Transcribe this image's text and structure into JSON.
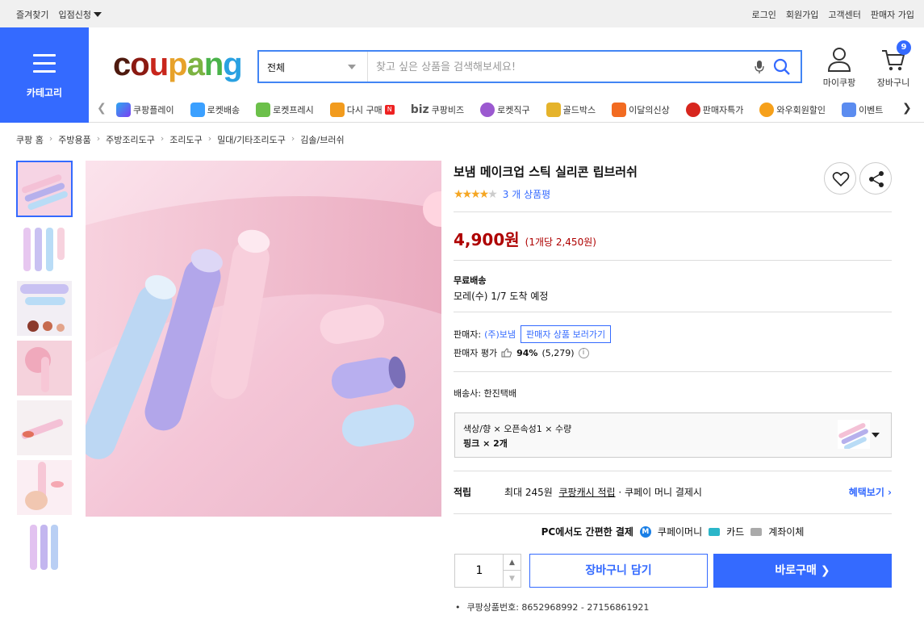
{
  "topbar": {
    "left": [
      "즐겨찾기",
      "입점신청"
    ],
    "right": [
      "로그인",
      "회원가입",
      "고객센터",
      "판매자 가입"
    ]
  },
  "header": {
    "category_label": "카테고리",
    "logo": "coupang",
    "search_category": "전체",
    "search_placeholder": "찾고 싶은 상품을 검색해보세요!",
    "mycoupang_label": "마이쿠팡",
    "cart_label": "장바구니",
    "cart_count": "9"
  },
  "services": [
    "쿠팡플레이",
    "로켓배송",
    "로켓프레시",
    "다시 구매",
    "쿠팡비즈",
    "로켓직구",
    "골드박스",
    "이달의신상",
    "판매자특가",
    "와우회원할인",
    "이벤트"
  ],
  "breadcrumb": [
    "쿠팡 홈",
    "주방용품",
    "주방조리도구",
    "조리도구",
    "밀대/기타조리도구",
    "김솔/브러쉬"
  ],
  "product": {
    "title": "보냄 메이크업 스틱 실리콘 립브러쉬",
    "rating": 3.5,
    "review_count": "3 개 상품평",
    "price": "4,900원",
    "unit_price": "(1개당 2,450원)",
    "shipping": "무료배송",
    "arrival": "모레(수) 1/7 도착 예정",
    "seller_label": "판매자:",
    "seller_name": "(주)보냄",
    "seller_link": "판매자 상품 보러가기",
    "seller_rating_label": "판매자 평가",
    "seller_rating": "94%",
    "seller_rating_count": "(5,279)",
    "courier": "배송사:  한진택배",
    "option_name": "색상/향 × 오픈속성1 × 수량",
    "option_value": "핑크 × 2개",
    "reward_title": "적립",
    "reward_max": "최대 245원",
    "reward_link": "쿠팡캐시 적립",
    "reward_tail": "· 쿠페이 머니 결제시",
    "reward_more": "혜택보기",
    "pay_title": "PC에서도 간편한 결제",
    "pay_methods": [
      "쿠페이머니",
      "카드",
      "계좌이체"
    ],
    "quantity": "1",
    "cart_button": "장바구니 담기",
    "buy_button": "바로구매",
    "product_no": "쿠팡상품번호: 8652968992 - 27156861921"
  },
  "colors": {
    "accent": "#346aff",
    "price": "#ae0000",
    "star": "#f5a623"
  }
}
